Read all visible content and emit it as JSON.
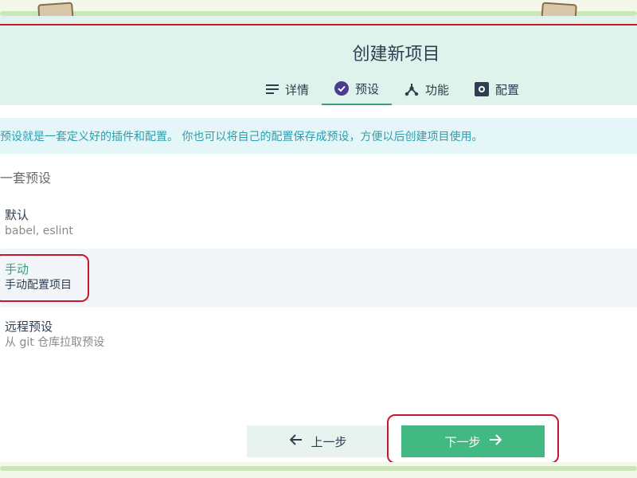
{
  "window": {
    "title": "创建新项目",
    "tabs": [
      {
        "label": "详情",
        "icon": "list-icon",
        "active": false
      },
      {
        "label": "预设",
        "icon": "check-circle-icon",
        "active": true
      },
      {
        "label": "功能",
        "icon": "fork-icon",
        "active": false
      },
      {
        "label": "配置",
        "icon": "settings-box-icon",
        "active": false
      }
    ]
  },
  "info_text": "预设就是一套定义好的插件和配置。 你也可以将自己的配置保存成预设，方便以后创建项目使用。",
  "section_title": "一套预设",
  "presets": [
    {
      "name": "默认",
      "desc": "babel, eslint"
    },
    {
      "name": "手动",
      "desc": "手动配置项目"
    },
    {
      "name": "远程预设",
      "desc": "从 git 仓库拉取预设"
    }
  ],
  "footer": {
    "prev_label": "上一步",
    "next_label": "下一步"
  },
  "colors": {
    "accent": "#42b983",
    "highlight_red": "#c8172f",
    "header_bg": "#dff3ec"
  }
}
